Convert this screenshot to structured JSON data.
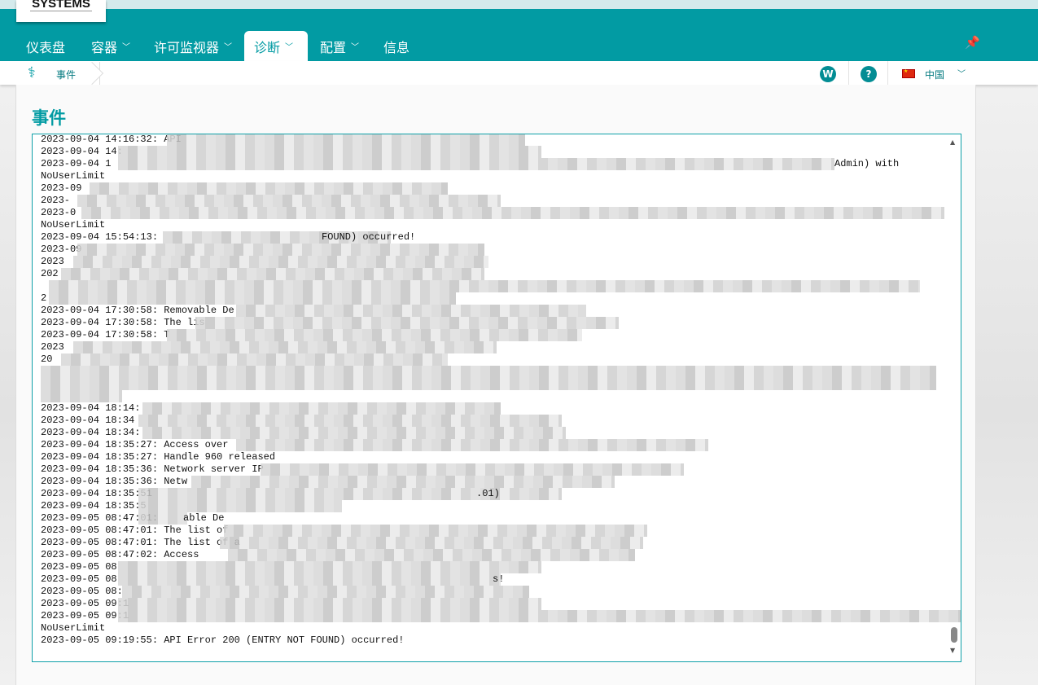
{
  "logo": {
    "text": "SYSTEMS"
  },
  "nav": [
    {
      "label": "仪表盘",
      "dropdown": false
    },
    {
      "label": "容器",
      "dropdown": true
    },
    {
      "label": "许可监视器",
      "dropdown": true
    },
    {
      "label": "诊断",
      "dropdown": true,
      "active": true
    },
    {
      "label": "配置",
      "dropdown": true
    },
    {
      "label": "信息",
      "dropdown": false
    }
  ],
  "icons": {
    "pin": "pin-icon",
    "breadcrumb": "stethoscope-icon",
    "w": "w-circle-icon",
    "help": "question-circle-icon",
    "flag": "china-flag-icon"
  },
  "breadcrumb": {
    "current": "事件"
  },
  "header_right": {
    "w_label": "W",
    "help_label": "?",
    "language": "中国"
  },
  "page": {
    "title": "事件"
  },
  "colors": {
    "brand": "#029ba3",
    "top_strip": "#d4eaec"
  },
  "log": {
    "lines": [
      {
        "text": "2023-09-04 14:16:32: API"
      },
      {
        "text": "2023-09-04 14:"
      },
      {
        "text": "2023-09-04 1",
        "tail": "Admin) with"
      },
      {
        "text": "NoUserLimit"
      },
      {
        "text": "2023-09"
      },
      {
        "text": "2023-"
      },
      {
        "text": "2023-0"
      },
      {
        "text": "NoUserLimit"
      },
      {
        "text": "2023-09-04 15:54:13:",
        "tail": "FOUND) occurred!"
      },
      {
        "text": "2023-09"
      },
      {
        "text": "2023"
      },
      {
        "text": "202"
      },
      {
        "text": ""
      },
      {
        "text": "2"
      },
      {
        "text": "2023-09-04 17:30:58: Removable De"
      },
      {
        "text": "2023-09-04 17:30:58: The lis"
      },
      {
        "text": "2023-09-04 17:30:58: T"
      },
      {
        "text": "2023"
      },
      {
        "text": "20"
      },
      {
        "text": ""
      },
      {
        "text": ""
      },
      {
        "text": ""
      },
      {
        "text": "2023-09-04 18:14:"
      },
      {
        "text": "2023-09-04 18:34"
      },
      {
        "text": "2023-09-04 18:34:"
      },
      {
        "text": "2023-09-04 18:35:27: Access over"
      },
      {
        "text": "2023-09-04 18:35:27: Handle 960 released"
      },
      {
        "text": "2023-09-04 18:35:36: Network server IP"
      },
      {
        "text": "2023-09-04 18:35:36: Netw"
      },
      {
        "text": "2023-09-04 18:35:51",
        "tail": ".01)"
      },
      {
        "text": "2023-09-04 18:35:5"
      },
      {
        "text": "2023-09-05 08:47:01:",
        "tail2": "able De"
      },
      {
        "text": "2023-09-05 08:47:01: The list of"
      },
      {
        "text": "2023-09-05 08:47:01: The list of a"
      },
      {
        "text": "2023-09-05 08:47:02: Access"
      },
      {
        "text": "2023-09-05 08"
      },
      {
        "text": "2023-09-05 08",
        "tail": "s!"
      },
      {
        "text": "2023-09-05 08:"
      },
      {
        "text": "2023-09-05 09:1"
      },
      {
        "text": "2023-09-05 09:1"
      },
      {
        "text": "NoUserLimit"
      },
      {
        "text": "2023-09-05 09:19:55: API Error 200 (ENTRY NOT FOUND) occurred!"
      }
    ]
  },
  "scrollbar": {
    "position_fraction": 0.97
  }
}
